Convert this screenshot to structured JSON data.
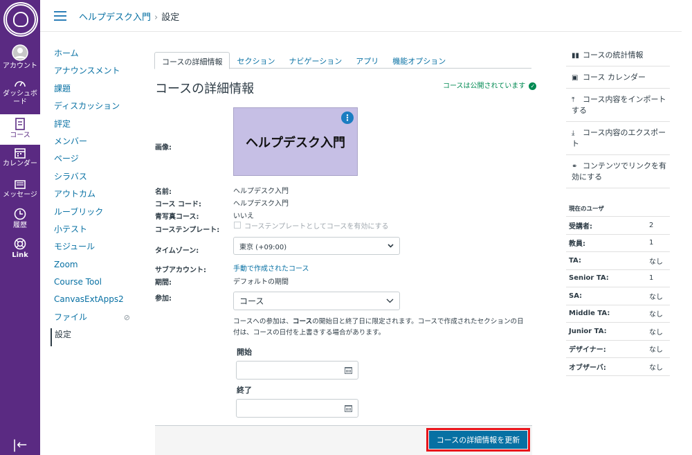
{
  "global_nav": {
    "items": [
      {
        "label": "アカウント",
        "icon": "avatar-icon"
      },
      {
        "label": "ダッシュボード",
        "icon": "dashboard-icon"
      },
      {
        "label": "コース",
        "icon": "course-icon"
      },
      {
        "label": "カレンダー",
        "icon": "calendar-icon"
      },
      {
        "label": "メッセージ",
        "icon": "inbox-icon"
      },
      {
        "label": "履歴",
        "icon": "history-icon"
      },
      {
        "label": "Link",
        "icon": "help-icon"
      }
    ],
    "collapse_icon": "|←",
    "brand_color": "#5a2a82"
  },
  "header": {
    "course_name": "ヘルプデスク入門",
    "separator": "›",
    "current_page": "設定"
  },
  "course_nav": {
    "items": [
      "ホーム",
      "アナウンスメント",
      "課題",
      "ディスカッション",
      "評定",
      "メンバー",
      "ページ",
      "シラバス",
      "アウトカム",
      "ルーブリック",
      "小テスト",
      "モジュール",
      "Zoom",
      "Course Tool",
      "CanvasExtApps2",
      "ファイル",
      "設定"
    ],
    "hidden_icon": "eye-slash-icon"
  },
  "tabs": [
    "コースの詳細情報",
    "セクション",
    "ナビゲーション",
    "アプリ",
    "機能オプション"
  ],
  "main": {
    "title": "コースの詳細情報",
    "published": "コースは公開されています",
    "image_label": "画像:",
    "card_text": "ヘルプデスク入門",
    "kebab": "⋮",
    "name_label": "名前:",
    "name_value": "ヘルプデスク入門",
    "code_label": "コース コード:",
    "code_value": "ヘルプデスク入門",
    "blueprint_label": "青写真コース:",
    "blueprint_value": "いいえ",
    "template_label": "コーステンプレート:",
    "template_checkbox": "コーステンプレートとしてコースを有効にする",
    "timezone_label": "タイムゾーン:",
    "timezone_value": "東京 (+09:00)",
    "subaccount_label": "サブアカウント:",
    "subaccount_value": "手動で作成されたコース",
    "term_label": "期間:",
    "term_value": "デフォルトの期間",
    "participation_label": "参加:",
    "participation_value": "コース",
    "note_pre": "コースへの参加は、",
    "note_bold": "コース",
    "note_post": "の開始日と終了日に限定されます。コースで作成されたセクションの日付は、コースの日付を上書きする場合があります。",
    "start_label": "開始",
    "end_label": "終了",
    "update_button": "コースの詳細情報を更新"
  },
  "sidebar": {
    "links": [
      {
        "icon": "bar-chart-icon",
        "label": "コースの統計情報"
      },
      {
        "icon": "calendar-icon",
        "label": "コース カレンダー"
      },
      {
        "icon": "upload-icon",
        "label": "コース内容をインポートする"
      },
      {
        "icon": "download-icon",
        "label": "コース内容のエクスポート"
      },
      {
        "icon": "link-icon",
        "label": "コンテンツでリンクを有効にする"
      }
    ],
    "users_heading": "現在のユーザ",
    "users": [
      {
        "role": "受講者:",
        "count": "2"
      },
      {
        "role": "教員:",
        "count": "1"
      },
      {
        "role": "TA:",
        "count": "なし"
      },
      {
        "role": "Senior TA:",
        "count": "1"
      },
      {
        "role": "SA:",
        "count": "なし"
      },
      {
        "role": "Middle TA:",
        "count": "なし"
      },
      {
        "role": "Junior TA:",
        "count": "なし"
      },
      {
        "role": "デザイナー:",
        "count": "なし"
      },
      {
        "role": "オブザーバ:",
        "count": "なし"
      }
    ]
  }
}
